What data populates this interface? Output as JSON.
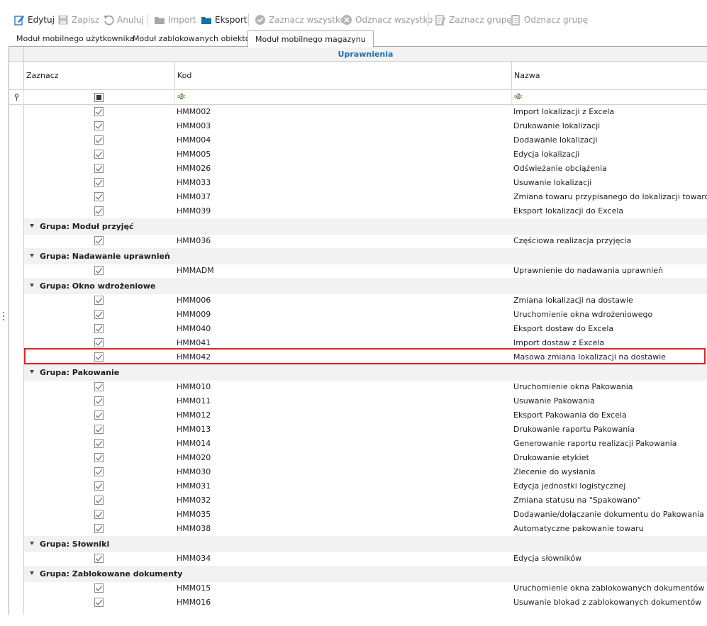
{
  "toolbar": {
    "edit": "Edytuj",
    "save": "Zapisz",
    "cancel": "Anuluj",
    "import": "Import",
    "export": "Eksport",
    "select_all": "Zaznacz wszystko",
    "deselect_all": "Odznacz wszystko",
    "select_group": "Zaznacz grupę",
    "deselect_group": "Odznacz grupę"
  },
  "tabs": [
    {
      "label": "Moduł mobilnego użytkownika",
      "active": false
    },
    {
      "label": "Moduł zablokowanych obiektów",
      "active": false
    },
    {
      "label": "Moduł mobilnego magazynu",
      "active": true
    }
  ],
  "grid": {
    "band_title": "Uprawnienia",
    "columns": {
      "zaznacz": "Zaznacz",
      "kod": "Kod",
      "nazwa": "Nazwa"
    },
    "filter_icon": "abc-filter-icon",
    "rows": [
      {
        "type": "row",
        "kod": "HMM002",
        "nazwa": "Import lokalizacji z Excela",
        "checked": true
      },
      {
        "type": "row",
        "kod": "HMM003",
        "nazwa": "Drukowanie lokalizacji",
        "checked": true
      },
      {
        "type": "row",
        "kod": "HMM004",
        "nazwa": "Dodawanie lokalizacji",
        "checked": true
      },
      {
        "type": "row",
        "kod": "HMM005",
        "nazwa": "Edycja lokalizacji",
        "checked": true
      },
      {
        "type": "row",
        "kod": "HMM026",
        "nazwa": "Odświeżanie obciążenia",
        "checked": true
      },
      {
        "type": "row",
        "kod": "HMM033",
        "nazwa": "Usuwanie lokalizacji",
        "checked": true
      },
      {
        "type": "row",
        "kod": "HMM037",
        "nazwa": "Zmiana towaru przypisanego do lokalizacji towarowej",
        "checked": true
      },
      {
        "type": "row",
        "kod": "HMM039",
        "nazwa": "Eksport lokalizacji do Excela",
        "checked": true
      },
      {
        "type": "group",
        "label": "Grupa: Moduł przyjęć"
      },
      {
        "type": "row",
        "kod": "HMM036",
        "nazwa": "Częściowa realizacja przyjęcia",
        "checked": true
      },
      {
        "type": "group",
        "label": "Grupa: Nadawanie uprawnień"
      },
      {
        "type": "row",
        "kod": "HMMADM",
        "nazwa": "Uprawnienie do nadawania uprawnień",
        "checked": true
      },
      {
        "type": "group",
        "label": "Grupa: Okno wdrożeniowe"
      },
      {
        "type": "row",
        "kod": "HMM006",
        "nazwa": "Zmiana lokalizacji na dostawie",
        "checked": true
      },
      {
        "type": "row",
        "kod": "HMM009",
        "nazwa": "Uruchomienie okna wdrożeniowego",
        "checked": true
      },
      {
        "type": "row",
        "kod": "HMM040",
        "nazwa": "Eksport dostaw do Excela",
        "checked": true
      },
      {
        "type": "row",
        "kod": "HMM041",
        "nazwa": "Import dostaw z Excela",
        "checked": true
      },
      {
        "type": "row",
        "kod": "HMM042",
        "nazwa": "Masowa zmiana lokalizacji na dostawie",
        "checked": true,
        "highlighted": true
      },
      {
        "type": "group",
        "label": "Grupa: Pakowanie"
      },
      {
        "type": "row",
        "kod": "HMM010",
        "nazwa": "Uruchomienie okna Pakowania",
        "checked": true
      },
      {
        "type": "row",
        "kod": "HMM011",
        "nazwa": "Usuwanie Pakowania",
        "checked": true
      },
      {
        "type": "row",
        "kod": "HMM012",
        "nazwa": "Eksport Pakowania do Excela",
        "checked": true
      },
      {
        "type": "row",
        "kod": "HMM013",
        "nazwa": "Drukowanie raportu Pakowania",
        "checked": true
      },
      {
        "type": "row",
        "kod": "HMM014",
        "nazwa": "Generowanie raportu realizacji Pakowania",
        "checked": true
      },
      {
        "type": "row",
        "kod": "HMM020",
        "nazwa": "Drukowanie etykiet",
        "checked": true
      },
      {
        "type": "row",
        "kod": "HMM030",
        "nazwa": "Zlecenie do wysłania",
        "checked": true
      },
      {
        "type": "row",
        "kod": "HMM031",
        "nazwa": "Edycja jednostki logistycznej",
        "checked": true
      },
      {
        "type": "row",
        "kod": "HMM032",
        "nazwa": "Zmiana statusu na \"Spakowano\"",
        "checked": true
      },
      {
        "type": "row",
        "kod": "HMM035",
        "nazwa": "Dodawanie/dołączanie dokumentu do Pakowania",
        "checked": true
      },
      {
        "type": "row",
        "kod": "HMM038",
        "nazwa": "Automatyczne pakowanie towaru",
        "checked": true
      },
      {
        "type": "group",
        "label": "Grupa: Słowniki"
      },
      {
        "type": "row",
        "kod": "HMM034",
        "nazwa": "Edycja słowników",
        "checked": true
      },
      {
        "type": "group",
        "label": "Grupa: Zablokowane dokumenty"
      },
      {
        "type": "row",
        "kod": "HMM015",
        "nazwa": "Uruchomienie okna zablokowanych dokumentów",
        "checked": true
      },
      {
        "type": "row",
        "kod": "HMM016",
        "nazwa": "Usuwanie blokad z zablokowanych dokumentów",
        "checked": true
      }
    ]
  },
  "colors": {
    "band_title": "#1f6fb5",
    "highlight_border": "#d9262b",
    "export_icon": "#1c6ea4",
    "edit_icon": "#2e7bc4"
  }
}
